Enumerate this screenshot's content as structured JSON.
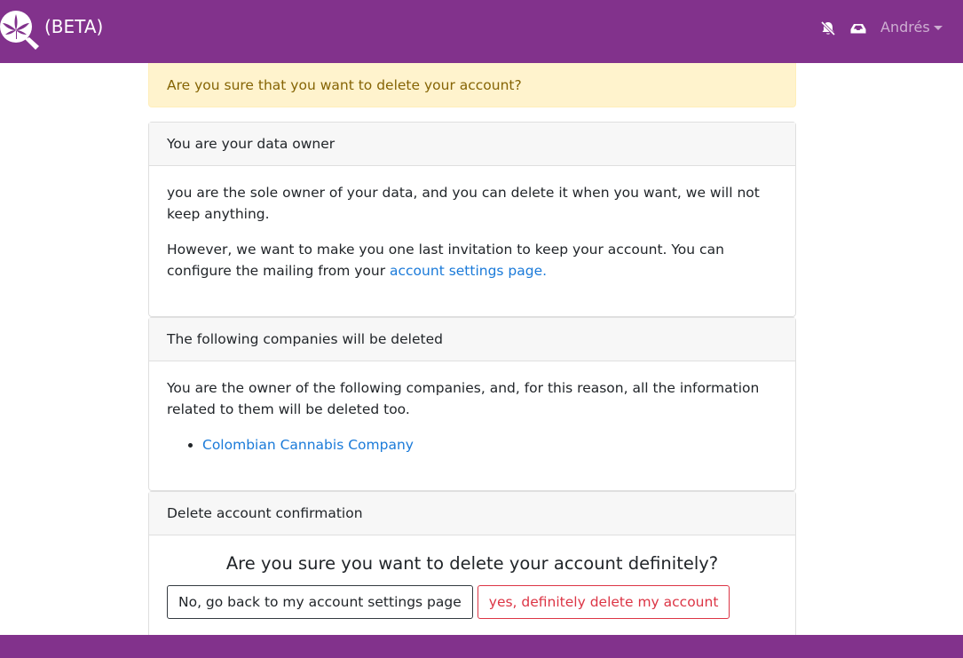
{
  "navbar": {
    "brand_text": "(BETA)",
    "user_name": "Andrés",
    "icons": [
      "logo-icon",
      "bell-slash-icon",
      "inbox-icon",
      "caret-down-icon"
    ],
    "color": "#82328c"
  },
  "alert": {
    "text": "Are you sure that you want to delete your account?"
  },
  "cards": {
    "data_owner": {
      "header": "You are your data owner",
      "paragraph1": "you are the sole owner of your data, and you can delete it when you want, we will not keep anything.",
      "paragraph2": "However, we want to make you one last invitation to keep your account. You can configure the mailing from your",
      "link": "account settings page."
    },
    "companies": {
      "header": "The following companies will be deleted",
      "paragraph": "You are the owner of the following companies, and, for this reason, all the information related to them will be deleted too.",
      "items": [
        "Colombian Cannabis Company"
      ]
    },
    "confirmation": {
      "header": "Delete account confirmation",
      "title": "Are you sure you want to delete your account definitely?",
      "cancel_label": "No, go back to my account settings page",
      "delete_label": "yes, definitely delete my account"
    }
  }
}
